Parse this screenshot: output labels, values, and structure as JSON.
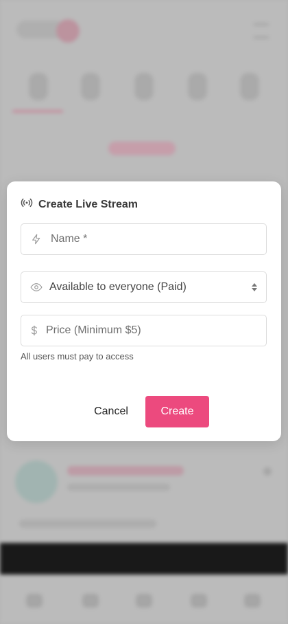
{
  "modal": {
    "title": "Create Live Stream",
    "name_placeholder": "Name *",
    "visibility_value": "Available to everyone (Paid)",
    "price_placeholder": "Price (Minimum $5)",
    "helper_text": "All users must pay to access",
    "cancel_label": "Cancel",
    "create_label": "Create"
  },
  "colors": {
    "accent": "#ec4a7e"
  },
  "icons": {
    "title": "broadcast-icon",
    "name": "lightning-icon",
    "visibility": "eye-icon",
    "price": "dollar-icon",
    "select": "chevron-up-down-icon"
  }
}
